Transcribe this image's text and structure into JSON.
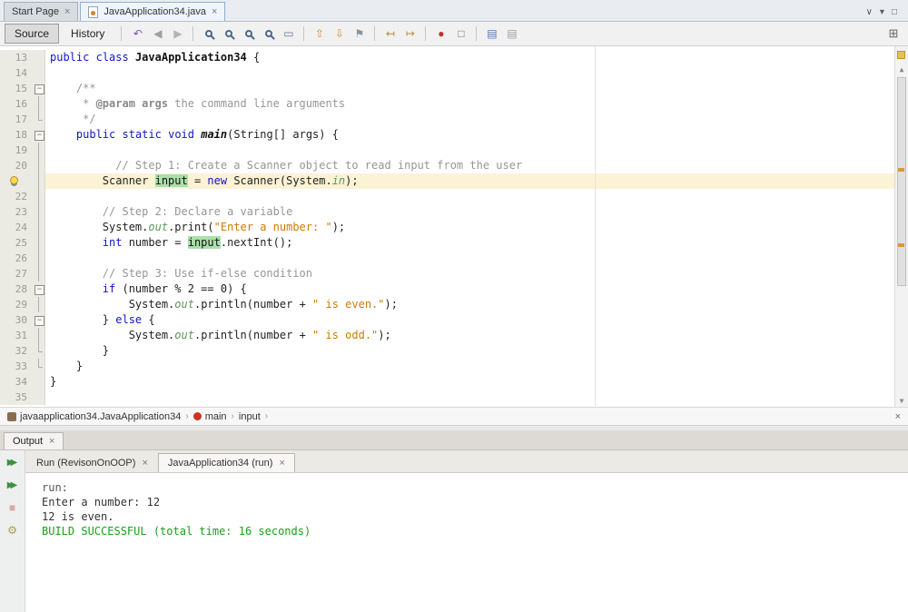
{
  "window": {
    "doc_tabs": [
      {
        "label": "Start Page",
        "close": "×",
        "active": false,
        "icon": false
      },
      {
        "label": "JavaApplication34.java",
        "close": "×",
        "active": true,
        "icon": true
      }
    ],
    "tab_bar_icons": [
      {
        "name": "minimize-window-group-icon",
        "glyph": "∨"
      },
      {
        "name": "document-list-dropdown-icon",
        "glyph": "▾"
      },
      {
        "name": "maximize-window-icon",
        "glyph": "□"
      }
    ]
  },
  "toolbar": {
    "source_label": "Source",
    "history_label": "History",
    "overflow_icon": "⊞",
    "icons": [
      {
        "kind": "glyph",
        "name": "last-edit-position-icon",
        "glyph": "↶",
        "color": "#7a5ab5"
      },
      {
        "kind": "glyph",
        "name": "back-icon",
        "glyph": "◀",
        "color": "#9aa0a8"
      },
      {
        "kind": "glyph",
        "name": "forward-icon",
        "glyph": "▶",
        "color": "#b0b4ba"
      },
      {
        "kind": "sep"
      },
      {
        "kind": "mag",
        "name": "find-selection-icon"
      },
      {
        "kind": "mag",
        "name": "find-next-icon"
      },
      {
        "kind": "mag",
        "name": "find-previous-icon"
      },
      {
        "kind": "mag",
        "name": "toggle-highlight-search-icon"
      },
      {
        "kind": "glyph",
        "name": "select-in-projects-icon",
        "glyph": "▭",
        "color": "#667788"
      },
      {
        "kind": "sep"
      },
      {
        "kind": "glyph",
        "name": "previous-bookmark-icon",
        "glyph": "⇧",
        "color": "#d98a2b"
      },
      {
        "kind": "glyph",
        "name": "next-bookmark-icon",
        "glyph": "⇩",
        "color": "#d98a2b"
      },
      {
        "kind": "glyph",
        "name": "toggle-bookmark-icon",
        "glyph": "⚑",
        "color": "#8b93a0"
      },
      {
        "kind": "sep"
      },
      {
        "kind": "glyph",
        "name": "shift-line-left-icon",
        "glyph": "↤",
        "color": "#b2922f"
      },
      {
        "kind": "glyph",
        "name": "shift-line-right-icon",
        "glyph": "↦",
        "color": "#b2922f"
      },
      {
        "kind": "sep"
      },
      {
        "kind": "glyph",
        "name": "start-macro-recording-icon",
        "glyph": "●",
        "color": "#c23030"
      },
      {
        "kind": "glyph",
        "name": "stop-macro-recording-icon",
        "glyph": "□",
        "color": "#777777"
      },
      {
        "kind": "sep"
      },
      {
        "kind": "glyph",
        "name": "comment-icon",
        "glyph": "▤",
        "color": "#5577aa"
      },
      {
        "kind": "glyph",
        "name": "uncomment-icon",
        "glyph": "▤",
        "color": "#99a0a8"
      }
    ]
  },
  "editor": {
    "lines": [
      {
        "n": 13,
        "fold": "",
        "segs": [
          [
            "kw",
            "public"
          ],
          [
            "pl",
            " "
          ],
          [
            "kw",
            "class"
          ],
          [
            "pl",
            " "
          ],
          [
            "cls",
            "JavaApplication34"
          ],
          [
            "pl",
            " {"
          ]
        ]
      },
      {
        "n": 14,
        "fold": "",
        "segs": []
      },
      {
        "n": 15,
        "fold": "box",
        "segs": [
          [
            "cm",
            "    /**"
          ]
        ]
      },
      {
        "n": 16,
        "fold": "line",
        "segs": [
          [
            "cm",
            "     * "
          ],
          [
            "cmt",
            "@param args"
          ],
          [
            "cm",
            " the command line arguments"
          ]
        ]
      },
      {
        "n": 17,
        "fold": "end",
        "segs": [
          [
            "cm",
            "     */"
          ]
        ]
      },
      {
        "n": 18,
        "fold": "box",
        "segs": [
          [
            "pl",
            "    "
          ],
          [
            "kw",
            "public"
          ],
          [
            "pl",
            " "
          ],
          [
            "kw",
            "static"
          ],
          [
            "pl",
            " "
          ],
          [
            "kw",
            "void"
          ],
          [
            "pl",
            " "
          ],
          [
            "mth",
            "main"
          ],
          [
            "pl",
            "(String[] args) {"
          ]
        ]
      },
      {
        "n": 19,
        "fold": "line",
        "segs": []
      },
      {
        "n": 20,
        "fold": "line",
        "segs": [
          [
            "cm",
            "          // Step 1: Create a Scanner object to read input from the user"
          ]
        ]
      },
      {
        "n": 21,
        "fold": "line",
        "bulb": true,
        "current": true,
        "segs": [
          [
            "pl",
            "        Scanner "
          ],
          [
            "occ",
            "input"
          ],
          [
            "pl",
            " = "
          ],
          [
            "kw",
            "new"
          ],
          [
            "pl",
            " Scanner(System."
          ],
          [
            "fld",
            "in"
          ],
          [
            "pl",
            ");"
          ]
        ]
      },
      {
        "n": 22,
        "fold": "line",
        "segs": []
      },
      {
        "n": 23,
        "fold": "line",
        "segs": [
          [
            "cm",
            "        // Step 2: Declare a variable"
          ]
        ]
      },
      {
        "n": 24,
        "fold": "line",
        "segs": [
          [
            "pl",
            "        System."
          ],
          [
            "fld",
            "out"
          ],
          [
            "pl",
            ".print("
          ],
          [
            "str",
            "\"Enter a number: \""
          ],
          [
            "pl",
            ");"
          ]
        ]
      },
      {
        "n": 25,
        "fold": "line",
        "segs": [
          [
            "pl",
            "        "
          ],
          [
            "kw",
            "int"
          ],
          [
            "pl",
            " number = "
          ],
          [
            "occ",
            "input"
          ],
          [
            "pl",
            ".nextInt();"
          ]
        ]
      },
      {
        "n": 26,
        "fold": "line",
        "segs": []
      },
      {
        "n": 27,
        "fold": "line",
        "segs": [
          [
            "cm",
            "        // Step 3: Use if-else condition"
          ]
        ]
      },
      {
        "n": 28,
        "fold": "box",
        "segs": [
          [
            "pl",
            "        "
          ],
          [
            "kw",
            "if"
          ],
          [
            "pl",
            " (number % 2 == 0) {"
          ]
        ]
      },
      {
        "n": 29,
        "fold": "line",
        "segs": [
          [
            "pl",
            "            System."
          ],
          [
            "fld",
            "out"
          ],
          [
            "pl",
            ".println(number + "
          ],
          [
            "str",
            "\" is even.\""
          ],
          [
            "pl",
            ");"
          ]
        ]
      },
      {
        "n": 30,
        "fold": "box",
        "segs": [
          [
            "pl",
            "        } "
          ],
          [
            "kw",
            "else"
          ],
          [
            "pl",
            " {"
          ]
        ]
      },
      {
        "n": 31,
        "fold": "line",
        "segs": [
          [
            "pl",
            "            System."
          ],
          [
            "fld",
            "out"
          ],
          [
            "pl",
            ".println(number + "
          ],
          [
            "str",
            "\" is odd.\""
          ],
          [
            "pl",
            ");"
          ]
        ]
      },
      {
        "n": 32,
        "fold": "end",
        "segs": [
          [
            "pl",
            "        }"
          ]
        ]
      },
      {
        "n": 33,
        "fold": "end",
        "segs": [
          [
            "pl",
            "    }"
          ]
        ]
      },
      {
        "n": 34,
        "fold": "",
        "segs": [
          [
            "pl",
            "}"
          ]
        ]
      },
      {
        "n": 35,
        "fold": "",
        "segs": []
      }
    ]
  },
  "breadcrumb": {
    "separator": "›",
    "close": "×",
    "items": [
      {
        "icon": "java-class-icon",
        "label": "javaapplication34.JavaApplication34"
      },
      {
        "icon": "method-icon",
        "label": "main"
      },
      {
        "icon": null,
        "label": "input"
      }
    ]
  },
  "output": {
    "panel_tab": {
      "label": "Output",
      "close": "×"
    },
    "side_icons": [
      {
        "name": "rerun-icon",
        "glyph": "▶▶",
        "color": "#3d9140",
        "replay": true
      },
      {
        "name": "rerun-with-args-icon",
        "glyph": "▶▶",
        "color": "#3d9140",
        "replay": true
      },
      {
        "name": "stop-icon",
        "glyph": "■",
        "color": "#d8a7a7",
        "replay": false
      },
      {
        "name": "ant-settings-icon",
        "glyph": "⚙",
        "color": "#b09a50",
        "replay": false
      }
    ],
    "run_tabs": [
      {
        "label": "Run (RevisonOnOOP)",
        "close": "×",
        "active": false
      },
      {
        "label": "JavaApplication34 (run)",
        "close": "×",
        "active": true
      }
    ],
    "console": [
      {
        "type": "meta",
        "text": "run:"
      },
      {
        "type": "plain",
        "text": "Enter a number: 12"
      },
      {
        "type": "plain",
        "text": "12 is even."
      },
      {
        "type": "success",
        "text": "BUILD SUCCESSFUL (total time: 16 seconds)"
      }
    ]
  },
  "colors": {
    "keyword": "#1414c8",
    "comment": "#969696",
    "string": "#ce7b00",
    "field": "#5a995a",
    "occurrence_highlight": "#aadfaa",
    "current_line": "#fcf2d4",
    "build_success": "#18a018",
    "error_stripe_mark": "#dd9933"
  }
}
